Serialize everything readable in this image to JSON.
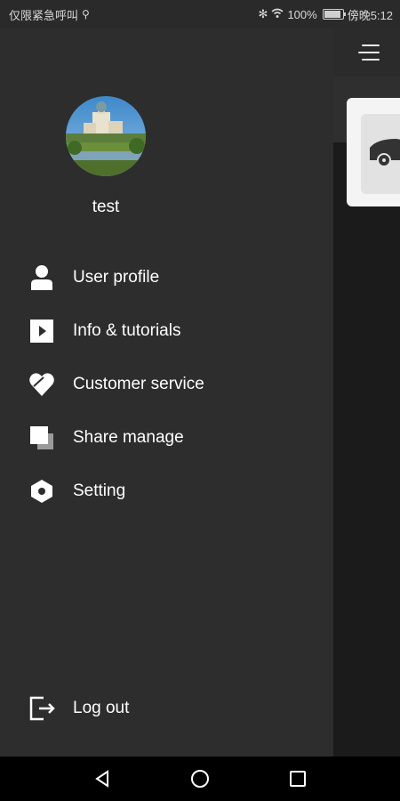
{
  "status_bar": {
    "left_text": "仅限紧急呼叫",
    "right_battery": "100%",
    "right_time": "傍晚5:12"
  },
  "drawer": {
    "username": "test",
    "menu": [
      {
        "label": "User profile",
        "icon": "user-icon"
      },
      {
        "label": "Info & tutorials",
        "icon": "play-icon"
      },
      {
        "label": "Customer service",
        "icon": "heart-icon"
      },
      {
        "label": "Share manage",
        "icon": "share-icon"
      },
      {
        "label": "Setting",
        "icon": "hexagon-icon"
      }
    ],
    "logout_label": "Log out"
  },
  "nav_bar": {
    "icons": [
      "back-icon",
      "home-icon",
      "recent-apps-icon"
    ]
  },
  "colors": {
    "drawer_bg": "#2d2d2d",
    "app_bg": "#1b1b1b",
    "text": "#ffffff"
  }
}
